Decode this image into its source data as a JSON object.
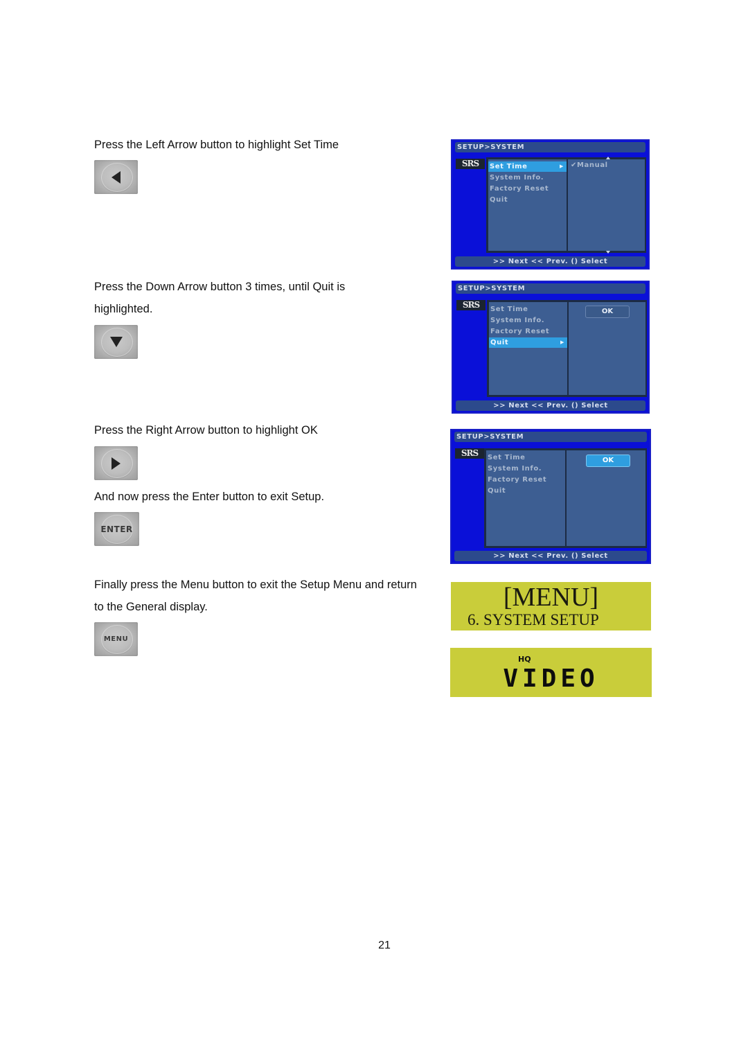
{
  "steps": [
    {
      "instruction": "Press the Left Arrow button to highlight Set Time",
      "button": {
        "icon": "left-arrow-icon",
        "label": ""
      }
    },
    {
      "instruction": "Press the Down Arrow button 3 times, until Quit is highlighted.",
      "button": {
        "icon": "down-arrow-icon",
        "label": ""
      }
    },
    {
      "instruction": "Press the Right Arrow button to highlight OK",
      "button": {
        "icon": "right-arrow-icon",
        "label": ""
      }
    },
    {
      "instruction": "And now press the Enter button to exit Setup.",
      "button": {
        "icon": "enter-button",
        "label": "ENTER"
      }
    },
    {
      "instruction": "Finally press the Menu button to exit the Setup Menu and return to the General display.",
      "button": {
        "icon": "menu-button",
        "label": "MENU"
      }
    }
  ],
  "osd_screens": [
    {
      "title": "SETUP>SYSTEM",
      "logo": "SRS",
      "menu_items": [
        "Set Time",
        "System Info.",
        "Factory Reset",
        "Quit"
      ],
      "selected_index": 0,
      "option": "✔Manual",
      "ok_label": "",
      "footer": ">> Next  << Prev.  () Select"
    },
    {
      "title": "SETUP>SYSTEM",
      "logo": "SRS",
      "menu_items": [
        "Set Time",
        "System Info.",
        "Factory Reset",
        "Quit"
      ],
      "selected_index": 3,
      "option": "",
      "ok_label": "OK",
      "ok_selected": false,
      "footer": ">> Next  << Prev.  () Select"
    },
    {
      "title": "SETUP>SYSTEM",
      "logo": "SRS",
      "menu_items": [
        "Set Time",
        "System Info.",
        "Factory Reset",
        "Quit"
      ],
      "selected_index": -1,
      "option": "",
      "ok_label": "OK",
      "ok_selected": true,
      "footer": ">> Next  << Prev.  () Select"
    }
  ],
  "lcd_displays": [
    {
      "line1": "[MENU]",
      "line2": "6. SYSTEM SETUP"
    },
    {
      "line1": "HQ",
      "line2": "VIDEO"
    }
  ],
  "colors": {
    "osd_background": "#0a10d8",
    "osd_panel": "#3d5e92",
    "osd_highlight": "#2f9ee0",
    "lcd_background": "#c9cd3a"
  },
  "page_number": "21"
}
